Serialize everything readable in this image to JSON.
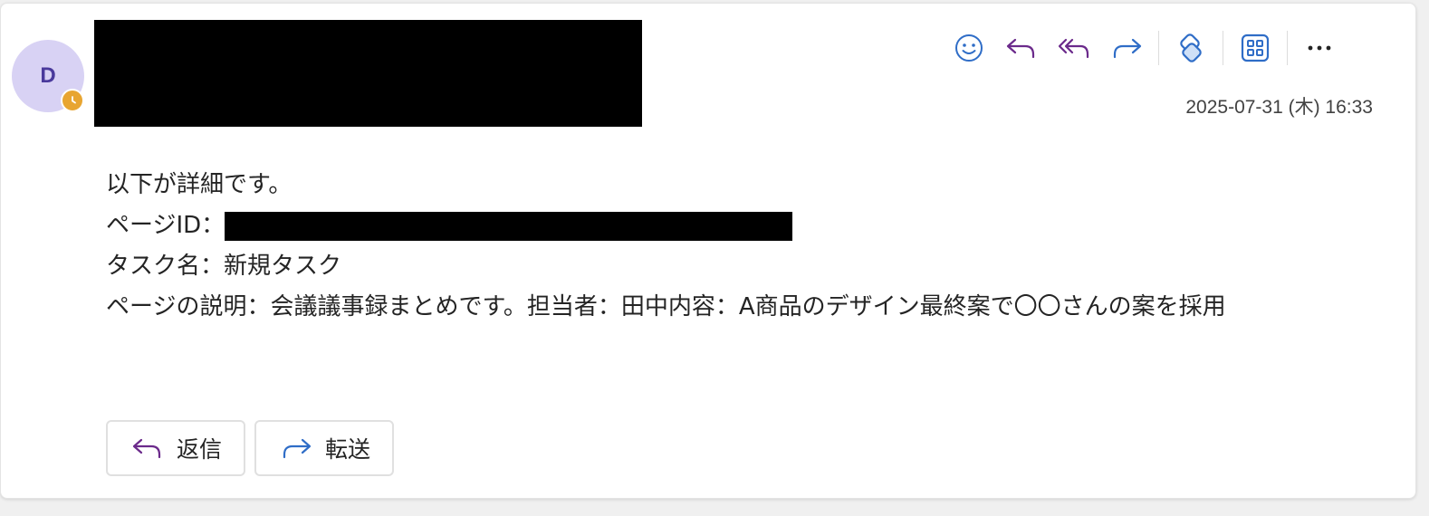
{
  "sender": {
    "avatar_initial": "D"
  },
  "message": {
    "date": "2025-07-31 (木) 16:33",
    "lines": {
      "line1": "以下が詳細です。",
      "line2_label": "ページID：",
      "line3": "タスク名：新規タスク",
      "line4": "ページの説明：会議議事録まとめです。担当者：田中内容：A商品のデザイン最終案で〇〇さんの案を採用"
    }
  },
  "actions": {
    "reply_label": "返信",
    "forward_label": "転送"
  },
  "colors": {
    "purple": "#6b2a8b",
    "blue": "#2f6dc7",
    "avatar_bg": "#d8d2f4",
    "presence": "#e8a531"
  },
  "toolbar_icons": [
    "smile-icon",
    "reply-icon",
    "reply-all-icon",
    "forward-icon",
    "loop-icon",
    "apps-icon",
    "more-icon"
  ]
}
